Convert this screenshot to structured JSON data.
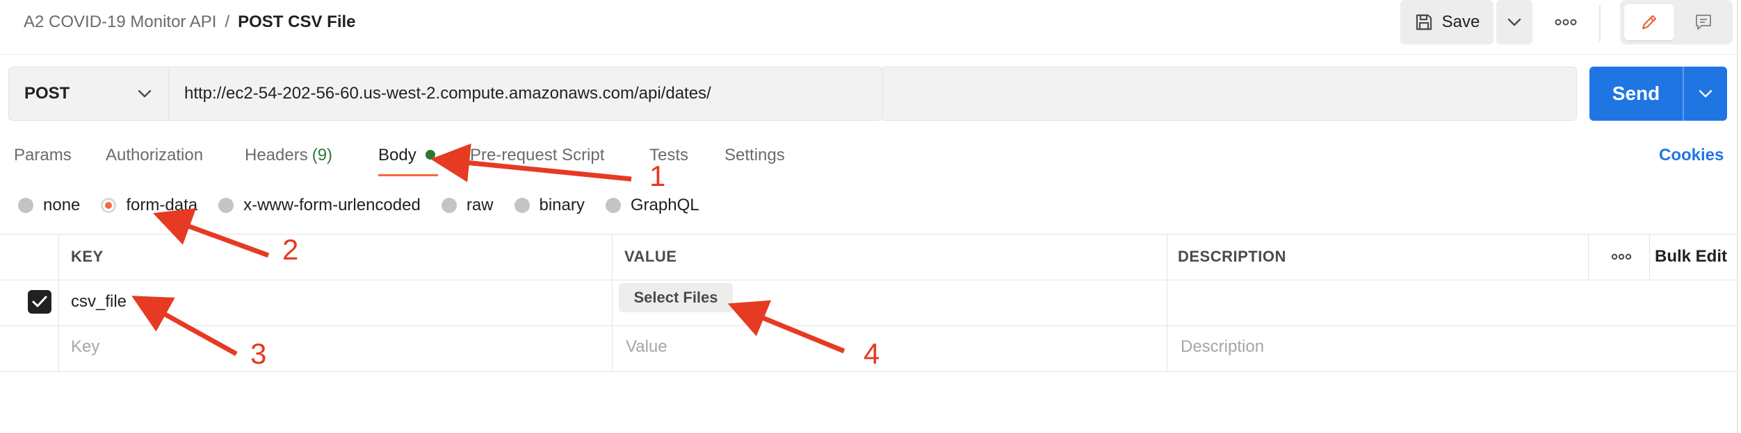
{
  "header": {
    "breadcrumb_parent": "A2 COVID-19 Monitor API",
    "breadcrumb_separator": "/",
    "breadcrumb_current": "POST CSV File",
    "save_label": "Save"
  },
  "request": {
    "method": "POST",
    "url": "http://ec2-54-202-56-60.us-west-2.compute.amazonaws.com/api/dates/",
    "send_label": "Send"
  },
  "tabs": [
    {
      "label": "Params"
    },
    {
      "label": "Authorization"
    },
    {
      "label": "Headers",
      "count": "(9)"
    },
    {
      "label": "Body"
    },
    {
      "label": "Pre-request Script"
    },
    {
      "label": "Tests"
    },
    {
      "label": "Settings"
    }
  ],
  "active_tab": "Body",
  "cookies_label": "Cookies",
  "body_types": [
    {
      "label": "none"
    },
    {
      "label": "form-data"
    },
    {
      "label": "x-www-form-urlencoded"
    },
    {
      "label": "raw"
    },
    {
      "label": "binary"
    },
    {
      "label": "GraphQL"
    }
  ],
  "selected_body_type": "form-data",
  "table": {
    "headers": {
      "key": "KEY",
      "value": "VALUE",
      "description": "DESCRIPTION"
    },
    "bulk_edit_label": "Bulk Edit",
    "rows": [
      {
        "checked": true,
        "key": "csv_file",
        "value_button": "Select Files",
        "description": ""
      }
    ],
    "placeholders": {
      "key": "Key",
      "value": "Value",
      "description": "Description"
    }
  },
  "annotations": [
    "1",
    "2",
    "3",
    "4"
  ],
  "colors": {
    "accent": "#f26b3a",
    "send": "#1f76e3",
    "link": "#1f76e3",
    "success_dot": "#2a7a32",
    "annotation": "#e63a23"
  },
  "icons": {
    "save": "floppy-disk-icon",
    "more": "ellipsis-icon",
    "edit": "pencil-icon",
    "comment": "comment-icon",
    "chevron": "chevron-down-icon",
    "check": "checkmark-icon"
  }
}
